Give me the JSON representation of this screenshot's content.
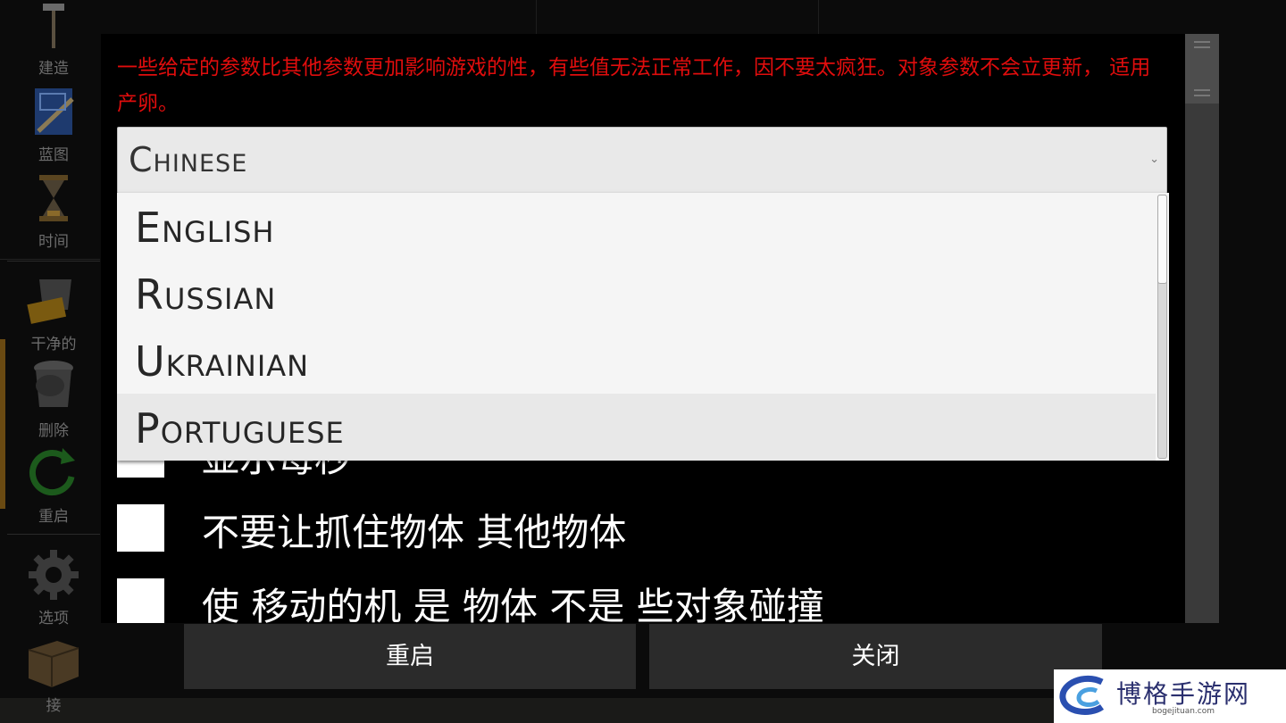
{
  "toolbar": {
    "items": [
      {
        "label": "建造",
        "icon": "build-hammer-icon"
      },
      {
        "label": "蓝图",
        "icon": "blueprint-icon"
      },
      {
        "label": "时间",
        "icon": "hourglass-icon"
      },
      {
        "label": "干净的",
        "icon": "bucket-icon"
      },
      {
        "label": "删除",
        "icon": "trash-can-icon"
      },
      {
        "label": "重启",
        "icon": "restart-arrow-icon"
      },
      {
        "label": "选项",
        "icon": "gear-icon"
      },
      {
        "label": "接",
        "icon": "box-icon"
      }
    ]
  },
  "dialog": {
    "notice": "一些给定的参数比其他参数更加影响游戏的性，有些值无法正常工作，因不要太疯狂。对象参数不会立更新， 适用 产卵。",
    "language_select": {
      "value": "Chinese",
      "options": [
        "English",
        "Russian",
        "Ukrainian",
        "Portuguese"
      ],
      "highlighted": "Portuguese"
    },
    "options": [
      {
        "label": "显示每秒",
        "checked": false
      },
      {
        "label": "不要让抓住物体  其他物体",
        "checked": false
      },
      {
        "label": "使  移动的机  是  物体 不是   些对象碰撞",
        "checked": false
      }
    ]
  },
  "buttons": {
    "restart": "重启",
    "close": "关闭"
  },
  "watermark": {
    "text": "博格手游网",
    "url": "bogejituan.com"
  },
  "colors": {
    "notice_red": "#e00d0d",
    "button_bg": "#2b2b2b",
    "dialog_bg": "#000000"
  }
}
